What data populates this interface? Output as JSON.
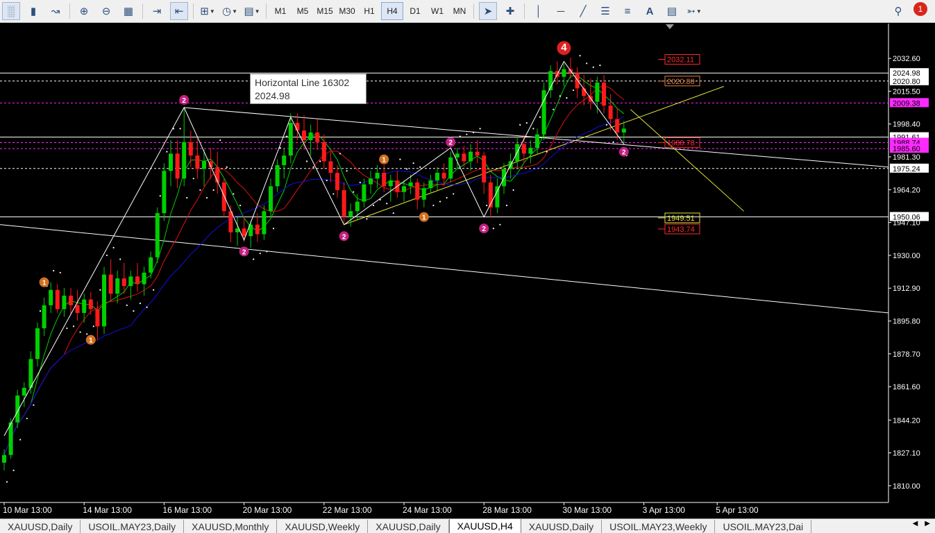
{
  "toolbar": {
    "timeframes": [
      {
        "label": "M1",
        "active": false
      },
      {
        "label": "M5",
        "active": false
      },
      {
        "label": "M15",
        "active": false
      },
      {
        "label": "M30",
        "active": false
      },
      {
        "label": "H1",
        "active": false
      },
      {
        "label": "H4",
        "active": true
      },
      {
        "label": "D1",
        "active": false
      },
      {
        "label": "W1",
        "active": false
      },
      {
        "label": "MN",
        "active": false
      }
    ],
    "notification_count": "1",
    "icons": [
      "bar-chart-icon",
      "candlestick-icon",
      "line-chart-icon",
      "zoom-in-icon",
      "zoom-out-icon",
      "tile-windows-icon",
      "auto-scroll-icon",
      "chart-shift-icon",
      "indicators-icon",
      "clock-icon",
      "templates-icon",
      "cursor-icon",
      "crosshair-icon",
      "vertical-line-icon",
      "horizontal-line-icon",
      "trendline-icon",
      "equidistant-channel-icon",
      "fibonacci-icon",
      "text-icon",
      "text-label-icon",
      "arrows-icon",
      "search-icon"
    ]
  },
  "tooltip": {
    "line1": "Horizontal Line 16302",
    "line2": "2024.98"
  },
  "tabs": [
    {
      "label": "XAUUSD,Daily",
      "active": false
    },
    {
      "label": "USOIL.MAY23,Daily",
      "active": false
    },
    {
      "label": "XAUUSD,Monthly",
      "active": false
    },
    {
      "label": "XAUUSD,Weekly",
      "active": false
    },
    {
      "label": "XAUUSD,Daily",
      "active": false
    },
    {
      "label": "XAUUSD,H4",
      "active": true
    },
    {
      "label": "XAUUSD,Daily",
      "active": false
    },
    {
      "label": "USOIL.MAY23,Weekly",
      "active": false
    },
    {
      "label": "USOIL.MAY23,Dai",
      "active": false
    }
  ],
  "colors": {
    "bull": "#00d000",
    "bear": "#ff1a1a",
    "ma_fast": "#00d000",
    "ma_mid": "#e01010",
    "ma_slow": "#1010e0",
    "channel": "#ffffff",
    "zigzag": "#ffffff",
    "yellow_line": "#e6e63c",
    "sar": "#ffffff",
    "price_tag_red": "#ff2a2a",
    "price_tag_magenta": "#ff2aff",
    "marker_magenta": "#c0207f",
    "marker_orange": "#d07020"
  },
  "chart_data": {
    "type": "candlestick",
    "symbol_timeframe": "XAUUSD,H4",
    "ylim": [
      1802,
      2050
    ],
    "price_ticks": [
      {
        "value": 2032.6,
        "label": "2032.60"
      },
      {
        "value": 2015.5,
        "label": "2015.50"
      },
      {
        "value": 1998.4,
        "label": "1998.40"
      },
      {
        "value": 1981.3,
        "label": "1981.30"
      },
      {
        "value": 1964.2,
        "label": "1964.20"
      },
      {
        "value": 1947.1,
        "label": "1947.10"
      },
      {
        "value": 1930.0,
        "label": "1930.00"
      },
      {
        "value": 1912.9,
        "label": "1912.90"
      },
      {
        "value": 1895.8,
        "label": "1895.80"
      },
      {
        "value": 1878.7,
        "label": "1878.70"
      },
      {
        "value": 1861.6,
        "label": "1861.60"
      },
      {
        "value": 1844.2,
        "label": "1844.20"
      },
      {
        "value": 1827.1,
        "label": "1827.10"
      },
      {
        "value": 1810.0,
        "label": "1810.00"
      }
    ],
    "time_ticks": [
      {
        "index": 0,
        "label": "10 Mar 13:00"
      },
      {
        "index": 12,
        "label": "14 Mar 13:00"
      },
      {
        "index": 24,
        "label": "16 Mar 13:00"
      },
      {
        "index": 36,
        "label": "20 Mar 13:00"
      },
      {
        "index": 48,
        "label": "22 Mar 13:00"
      },
      {
        "index": 60,
        "label": "24 Mar 13:00"
      },
      {
        "index": 72,
        "label": "28 Mar 13:00"
      },
      {
        "index": 84,
        "label": "30 Mar 13:00"
      },
      {
        "index": 96,
        "label": "3 Apr 13:00"
      },
      {
        "index": 107,
        "label": "5 Apr 13:00"
      }
    ],
    "price_tags": [
      {
        "value": 2024.98,
        "label": "2024.98",
        "style": "white"
      },
      {
        "value": 2020.8,
        "label": "2020.80",
        "style": "white"
      },
      {
        "value": 2009.38,
        "label": "2009.38",
        "style": "magenta"
      },
      {
        "value": 1991.61,
        "label": "1991.61",
        "style": "white"
      },
      {
        "value": 1988.74,
        "label": "1988.74",
        "style": "magenta"
      },
      {
        "value": 1985.6,
        "label": "1985.60",
        "style": "magenta"
      },
      {
        "value": 1975.24,
        "label": "1975.24",
        "style": "white"
      },
      {
        "value": 1950.06,
        "label": "1950.06",
        "style": "white"
      }
    ],
    "level_labels": [
      {
        "value": 2032.11,
        "label": "2032.11",
        "color": "#ff2a2a"
      },
      {
        "value": 2020.8,
        "label": "2020.80",
        "color": "#e08040"
      },
      {
        "value": 1988.78,
        "label": "1988.78",
        "color": "#ff2a2a"
      },
      {
        "value": 1949.51,
        "label": "1949.51",
        "color": "#e6e63c"
      },
      {
        "value": 1943.74,
        "label": "1943.74",
        "color": "#ff2a2a"
      }
    ],
    "horizontal_lines": [
      {
        "value": 2024.98,
        "style": "solid",
        "color": "#ffffff"
      },
      {
        "value": 2020.8,
        "style": "dashed",
        "color": "#ffffff"
      },
      {
        "value": 2009.38,
        "style": "dashed",
        "color": "#ff2aff"
      },
      {
        "value": 1991.61,
        "style": "solid",
        "color": "#ffffff"
      },
      {
        "value": 1988.74,
        "style": "dashed",
        "color": "#ff2aff"
      },
      {
        "value": 1985.6,
        "style": "dashed",
        "color": "#ff2aff"
      },
      {
        "value": 1975.24,
        "style": "dashed",
        "color": "#ffffff"
      },
      {
        "value": 1950.06,
        "style": "solid",
        "color": "#ffffff"
      }
    ],
    "candles": [
      {
        "o": 1822,
        "h": 1829,
        "l": 1818,
        "c": 1826
      },
      {
        "o": 1826,
        "h": 1845,
        "l": 1824,
        "c": 1843
      },
      {
        "o": 1843,
        "h": 1860,
        "l": 1840,
        "c": 1857
      },
      {
        "o": 1857,
        "h": 1864,
        "l": 1851,
        "c": 1861
      },
      {
        "o": 1861,
        "h": 1880,
        "l": 1858,
        "c": 1876
      },
      {
        "o": 1876,
        "h": 1895,
        "l": 1872,
        "c": 1892
      },
      {
        "o": 1892,
        "h": 1908,
        "l": 1888,
        "c": 1904
      },
      {
        "o": 1904,
        "h": 1916,
        "l": 1900,
        "c": 1912
      },
      {
        "o": 1912,
        "h": 1915,
        "l": 1900,
        "c": 1902
      },
      {
        "o": 1902,
        "h": 1913,
        "l": 1898,
        "c": 1909
      },
      {
        "o": 1909,
        "h": 1913,
        "l": 1899,
        "c": 1904
      },
      {
        "o": 1904,
        "h": 1912,
        "l": 1896,
        "c": 1900
      },
      {
        "o": 1900,
        "h": 1910,
        "l": 1895,
        "c": 1907
      },
      {
        "o": 1907,
        "h": 1911,
        "l": 1899,
        "c": 1902
      },
      {
        "o": 1902,
        "h": 1906,
        "l": 1886,
        "c": 1893
      },
      {
        "o": 1893,
        "h": 1924,
        "l": 1889,
        "c": 1920
      },
      {
        "o": 1920,
        "h": 1928,
        "l": 1906,
        "c": 1910
      },
      {
        "o": 1910,
        "h": 1922,
        "l": 1905,
        "c": 1918
      },
      {
        "o": 1918,
        "h": 1926,
        "l": 1910,
        "c": 1914
      },
      {
        "o": 1914,
        "h": 1922,
        "l": 1907,
        "c": 1919
      },
      {
        "o": 1919,
        "h": 1926,
        "l": 1911,
        "c": 1915
      },
      {
        "o": 1915,
        "h": 1924,
        "l": 1909,
        "c": 1921
      },
      {
        "o": 1921,
        "h": 1932,
        "l": 1918,
        "c": 1929
      },
      {
        "o": 1929,
        "h": 1955,
        "l": 1926,
        "c": 1952
      },
      {
        "o": 1952,
        "h": 1978,
        "l": 1948,
        "c": 1974
      },
      {
        "o": 1974,
        "h": 1990,
        "l": 1966,
        "c": 1983
      },
      {
        "o": 1983,
        "h": 1990,
        "l": 1965,
        "c": 1970
      },
      {
        "o": 1970,
        "h": 2007,
        "l": 1966,
        "c": 1989
      },
      {
        "o": 1989,
        "h": 1995,
        "l": 1976,
        "c": 1982
      },
      {
        "o": 1982,
        "h": 1991,
        "l": 1970,
        "c": 1975
      },
      {
        "o": 1975,
        "h": 1985,
        "l": 1966,
        "c": 1979
      },
      {
        "o": 1979,
        "h": 1986,
        "l": 1970,
        "c": 1976
      },
      {
        "o": 1976,
        "h": 1984,
        "l": 1962,
        "c": 1968
      },
      {
        "o": 1968,
        "h": 1970,
        "l": 1950,
        "c": 1953
      },
      {
        "o": 1953,
        "h": 1956,
        "l": 1937,
        "c": 1942
      },
      {
        "o": 1942,
        "h": 1950,
        "l": 1935,
        "c": 1944
      },
      {
        "o": 1944,
        "h": 1950,
        "l": 1937,
        "c": 1940
      },
      {
        "o": 1940,
        "h": 1948,
        "l": 1934,
        "c": 1946
      },
      {
        "o": 1946,
        "h": 1952,
        "l": 1937,
        "c": 1941
      },
      {
        "o": 1941,
        "h": 1956,
        "l": 1938,
        "c": 1953
      },
      {
        "o": 1953,
        "h": 1970,
        "l": 1950,
        "c": 1966
      },
      {
        "o": 1966,
        "h": 1980,
        "l": 1963,
        "c": 1977
      },
      {
        "o": 1977,
        "h": 1986,
        "l": 1970,
        "c": 1982
      },
      {
        "o": 1982,
        "h": 2004,
        "l": 1978,
        "c": 1999
      },
      {
        "o": 1999,
        "h": 2004,
        "l": 1990,
        "c": 1995
      },
      {
        "o": 1995,
        "h": 2003,
        "l": 1985,
        "c": 1990
      },
      {
        "o": 1990,
        "h": 1998,
        "l": 1982,
        "c": 1994
      },
      {
        "o": 1994,
        "h": 2001,
        "l": 1985,
        "c": 1989
      },
      {
        "o": 1989,
        "h": 1993,
        "l": 1975,
        "c": 1979
      },
      {
        "o": 1979,
        "h": 1984,
        "l": 1968,
        "c": 1973
      },
      {
        "o": 1973,
        "h": 1977,
        "l": 1960,
        "c": 1964
      },
      {
        "o": 1964,
        "h": 1968,
        "l": 1947,
        "c": 1950
      },
      {
        "o": 1950,
        "h": 1957,
        "l": 1945,
        "c": 1953
      },
      {
        "o": 1953,
        "h": 1962,
        "l": 1949,
        "c": 1958
      },
      {
        "o": 1958,
        "h": 1970,
        "l": 1955,
        "c": 1967
      },
      {
        "o": 1967,
        "h": 1974,
        "l": 1962,
        "c": 1970
      },
      {
        "o": 1970,
        "h": 1977,
        "l": 1965,
        "c": 1973
      },
      {
        "o": 1973,
        "h": 1977,
        "l": 1963,
        "c": 1966
      },
      {
        "o": 1966,
        "h": 1972,
        "l": 1958,
        "c": 1969
      },
      {
        "o": 1969,
        "h": 1974,
        "l": 1960,
        "c": 1963
      },
      {
        "o": 1963,
        "h": 1969,
        "l": 1958,
        "c": 1966
      },
      {
        "o": 1966,
        "h": 1972,
        "l": 1962,
        "c": 1968
      },
      {
        "o": 1968,
        "h": 1970,
        "l": 1954,
        "c": 1959
      },
      {
        "o": 1959,
        "h": 1968,
        "l": 1955,
        "c": 1965
      },
      {
        "o": 1965,
        "h": 1972,
        "l": 1962,
        "c": 1969
      },
      {
        "o": 1969,
        "h": 1976,
        "l": 1964,
        "c": 1973
      },
      {
        "o": 1973,
        "h": 1978,
        "l": 1966,
        "c": 1970
      },
      {
        "o": 1970,
        "h": 1984,
        "l": 1968,
        "c": 1981
      },
      {
        "o": 1981,
        "h": 1986,
        "l": 1975,
        "c": 1983
      },
      {
        "o": 1983,
        "h": 1987,
        "l": 1976,
        "c": 1979
      },
      {
        "o": 1979,
        "h": 1988,
        "l": 1974,
        "c": 1984
      },
      {
        "o": 1984,
        "h": 1990,
        "l": 1978,
        "c": 1982
      },
      {
        "o": 1982,
        "h": 1984,
        "l": 1962,
        "c": 1968
      },
      {
        "o": 1968,
        "h": 1972,
        "l": 1950,
        "c": 1955
      },
      {
        "o": 1955,
        "h": 1970,
        "l": 1952,
        "c": 1966
      },
      {
        "o": 1966,
        "h": 1978,
        "l": 1962,
        "c": 1975
      },
      {
        "o": 1975,
        "h": 1983,
        "l": 1970,
        "c": 1979
      },
      {
        "o": 1979,
        "h": 1992,
        "l": 1976,
        "c": 1988
      },
      {
        "o": 1988,
        "h": 1993,
        "l": 1978,
        "c": 1983
      },
      {
        "o": 1983,
        "h": 1990,
        "l": 1978,
        "c": 1986
      },
      {
        "o": 1986,
        "h": 1996,
        "l": 1983,
        "c": 1993
      },
      {
        "o": 1993,
        "h": 2020,
        "l": 1990,
        "c": 2016
      },
      {
        "o": 2016,
        "h": 2029,
        "l": 2012,
        "c": 2026
      },
      {
        "o": 2026,
        "h": 2031,
        "l": 2019,
        "c": 2023
      },
      {
        "o": 2023,
        "h": 2030,
        "l": 2018,
        "c": 2027
      },
      {
        "o": 2027,
        "h": 2033,
        "l": 2022,
        "c": 2025
      },
      {
        "o": 2025,
        "h": 2028,
        "l": 2012,
        "c": 2017
      },
      {
        "o": 2017,
        "h": 2024,
        "l": 2008,
        "c": 2013
      },
      {
        "o": 2013,
        "h": 2022,
        "l": 2006,
        "c": 2010
      },
      {
        "o": 2010,
        "h": 2023,
        "l": 2004,
        "c": 2020
      },
      {
        "o": 2020,
        "h": 2024,
        "l": 2004,
        "c": 2008
      },
      {
        "o": 2008,
        "h": 2014,
        "l": 1995,
        "c": 2001
      },
      {
        "o": 2001,
        "h": 2007,
        "l": 1990,
        "c": 1994
      },
      {
        "o": 1994,
        "h": 2000,
        "l": 1988,
        "c": 1996
      }
    ],
    "zigzag_pivots": [
      {
        "i": 0,
        "p": 1836
      },
      {
        "i": 27,
        "p": 2007
      },
      {
        "i": 36,
        "p": 1938
      },
      {
        "i": 43,
        "p": 2002
      },
      {
        "i": 51,
        "p": 1946
      },
      {
        "i": 67,
        "p": 1986
      },
      {
        "i": 72,
        "p": 1950
      },
      {
        "i": 84,
        "p": 2031
      },
      {
        "i": 93,
        "p": 1988
      }
    ],
    "wave_markers": [
      {
        "i": 27,
        "p": 2011,
        "text": "2",
        "color": "magenta",
        "pos": "above"
      },
      {
        "i": 36,
        "p": 1932,
        "text": "2",
        "color": "magenta",
        "pos": "below"
      },
      {
        "i": 51,
        "p": 1940,
        "text": "2",
        "color": "magenta",
        "pos": "below"
      },
      {
        "i": 67,
        "p": 1989,
        "text": "2",
        "color": "magenta",
        "pos": "above"
      },
      {
        "i": 72,
        "p": 1944,
        "text": "2",
        "color": "magenta",
        "pos": "below"
      },
      {
        "i": 93,
        "p": 1984,
        "text": "2",
        "color": "magenta",
        "pos": "below"
      },
      {
        "i": 6,
        "p": 1916,
        "text": "1",
        "color": "orange",
        "pos": "above"
      },
      {
        "i": 13,
        "p": 1886,
        "text": "1",
        "color": "orange",
        "pos": "below"
      },
      {
        "i": 57,
        "p": 1980,
        "text": "1",
        "color": "orange",
        "pos": "above"
      },
      {
        "i": 63,
        "p": 1950,
        "text": "1",
        "color": "orange",
        "pos": "below"
      },
      {
        "i": 84,
        "p": 2038,
        "text": "4",
        "color": "red",
        "pos": "above"
      }
    ]
  }
}
